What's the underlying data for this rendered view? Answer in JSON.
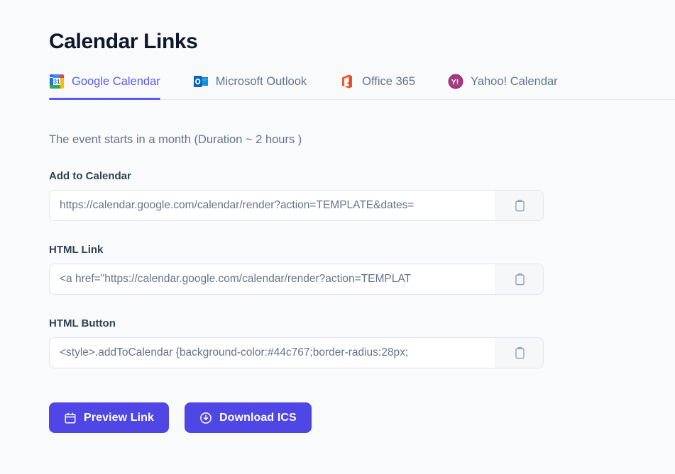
{
  "page": {
    "title": "Calendar Links"
  },
  "tabs": [
    {
      "label": "Google Calendar",
      "icon": "google-calendar-icon",
      "active": true
    },
    {
      "label": "Microsoft Outlook",
      "icon": "microsoft-outlook-icon",
      "active": false
    },
    {
      "label": "Office 365",
      "icon": "office-365-icon",
      "active": false
    },
    {
      "label": "Yahoo! Calendar",
      "icon": "yahoo-calendar-icon",
      "active": false
    }
  ],
  "description": "The event starts in a month (Duration ~ 2 hours )",
  "fields": [
    {
      "label": "Add to Calendar",
      "value": "https://calendar.google.com/calendar/render?action=TEMPLATE&dates=",
      "copy_icon": "clipboard-icon"
    },
    {
      "label": "HTML Link",
      "value": "<a href=\"https://calendar.google.com/calendar/render?action=TEMPLAT",
      "copy_icon": "clipboard-icon"
    },
    {
      "label": "HTML Button",
      "value": "<style>.addToCalendar {background-color:#44c767;border-radius:28px;",
      "copy_icon": "clipboard-icon"
    }
  ],
  "actions": [
    {
      "label": "Preview Link",
      "icon": "calendar-icon"
    },
    {
      "label": "Download ICS",
      "icon": "download-circle-icon"
    }
  ],
  "colors": {
    "accent": "#4f46e5",
    "tab_active": "#5b5bf0",
    "page_background": "#f8fafc",
    "muted_text": "#64748b"
  }
}
